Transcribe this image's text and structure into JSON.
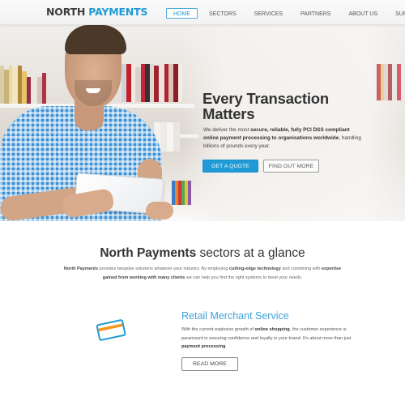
{
  "header": {
    "logo": {
      "part1": "NORTH",
      "part2": "PAYMENTS"
    },
    "nav": [
      {
        "label": "HOME",
        "active": true
      },
      {
        "label": "SECTORS",
        "active": false
      },
      {
        "label": "SERVICES",
        "active": false
      },
      {
        "label": "PARTNERS",
        "active": false
      },
      {
        "label": "ABOUT US",
        "active": false
      },
      {
        "label": "SUPPORT",
        "active": false
      }
    ]
  },
  "hero": {
    "title_line1": "Every Transaction",
    "title_line2": "Matters",
    "text": {
      "t1": "We deliver the most ",
      "b1": "secure, reliable, fully PCI DSS compliant online payment processing to organisations worldwide",
      "t2": ", handling billions of pounds every year."
    },
    "buttons": {
      "quote": "GET A QUOTE",
      "find_out": "FIND OUT MORE"
    }
  },
  "sectors": {
    "title_bold": "North Payments",
    "title_rest": " sectors at a glance",
    "desc": {
      "b1": "North Payments",
      "t1": " provides bespoke solutions whatever your industry. By employing ",
      "b2": "cutting-edge technology",
      "t2": " and combining with ",
      "b3": "expertise gained from working with many clients",
      "t3": " we can help you find the right systems to meet your needs."
    }
  },
  "retail": {
    "icon": "credit-card-icon",
    "title": "Retail Merchant Service",
    "text": {
      "t1": "With the current explosive growth of ",
      "b1": "online shopping",
      "t2": ", the customer experience is paramount in ensuring confidence and loyalty in your brand.  It's about more than just ",
      "b2": "payment processing",
      "t3": "."
    },
    "button": "READ MORE"
  },
  "colors": {
    "brand_blue": "#1f9ad6",
    "brand_dark": "#3d3d3d",
    "accent_orange": "#f7941d"
  }
}
